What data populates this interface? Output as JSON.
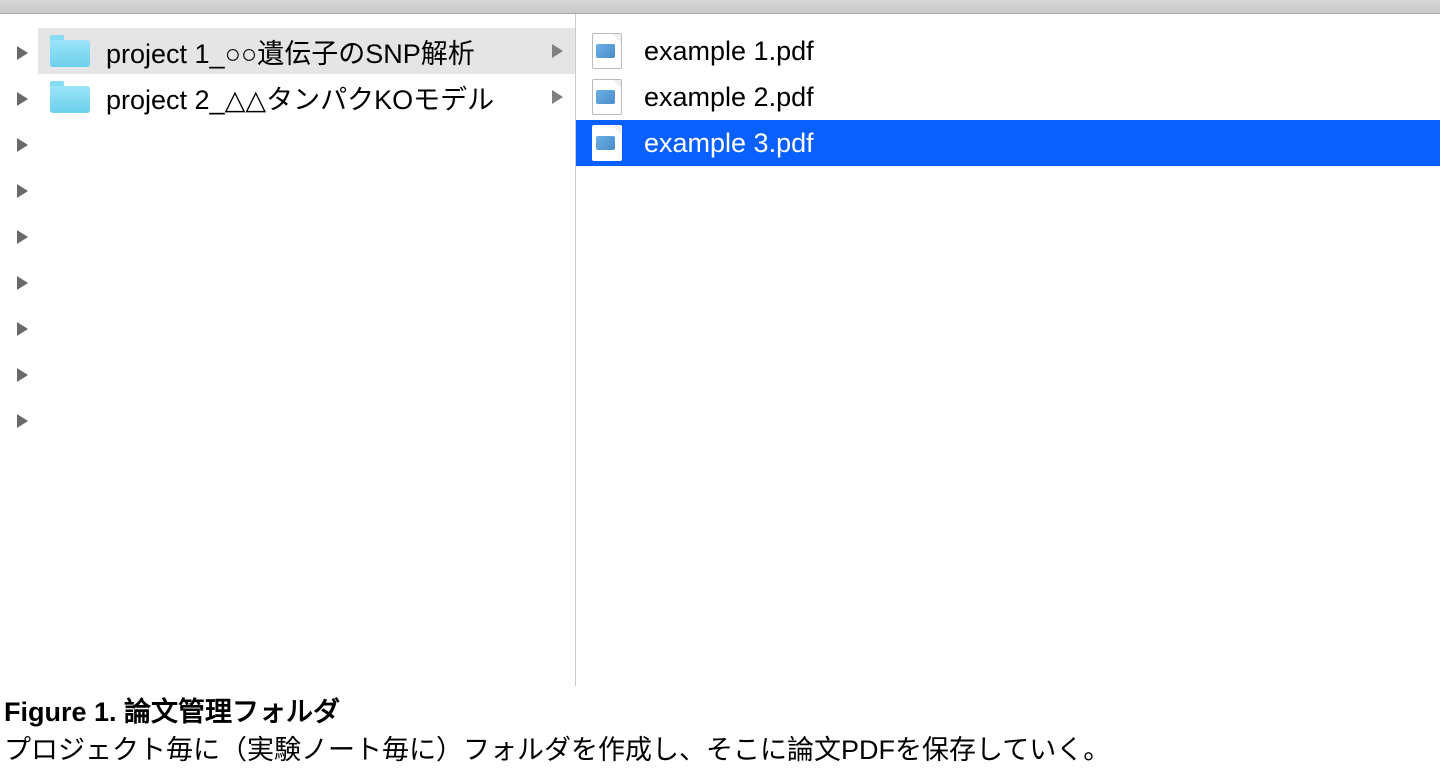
{
  "sidebar": {
    "chevron_count": 9
  },
  "left_pane": {
    "folders": [
      {
        "name": "project 1_○○遺伝子のSNP解析",
        "selected": true
      },
      {
        "name": "project 2_△△タンパクKOモデル",
        "selected": false
      }
    ]
  },
  "right_pane": {
    "files": [
      {
        "name": "example 1.pdf",
        "selected": false
      },
      {
        "name": "example 2.pdf",
        "selected": false
      },
      {
        "name": "example 3.pdf",
        "selected": true
      }
    ]
  },
  "caption": {
    "title": "Figure 1. 論文管理フォルダ",
    "body": "プロジェクト毎に（実験ノート毎に）フォルダを作成し、そこに論文PDFを保存していく。"
  }
}
